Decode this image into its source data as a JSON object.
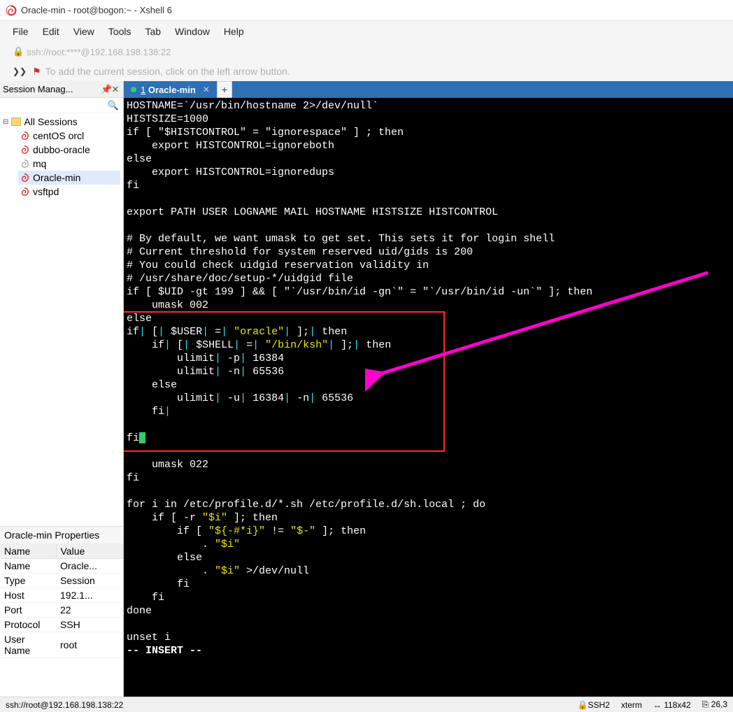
{
  "titlebar": {
    "text": "Oracle-min - root@bogon:~ - Xshell 6"
  },
  "menubar": [
    "File",
    "Edit",
    "View",
    "Tools",
    "Tab",
    "Window",
    "Help"
  ],
  "addressbar": {
    "url": "ssh://root:****@192.168.198.138:22"
  },
  "tipbar": {
    "text": "To add the current session, click on the left arrow button."
  },
  "session_panel": {
    "title": "Session Manag...",
    "root": "All Sessions",
    "items": [
      {
        "name": "centOS orcl",
        "color": "red",
        "selected": false
      },
      {
        "name": "dubbo-oracle",
        "color": "red",
        "selected": false
      },
      {
        "name": "mq",
        "color": "grey",
        "selected": false
      },
      {
        "name": "Oracle-min",
        "color": "red",
        "selected": true
      },
      {
        "name": "vsftpd",
        "color": "red",
        "selected": false
      }
    ]
  },
  "properties": {
    "title": "Oracle-min Properties",
    "headers": {
      "name": "Name",
      "value": "Value"
    },
    "rows": [
      {
        "name": "Name",
        "value": "Oracle..."
      },
      {
        "name": "Type",
        "value": "Session"
      },
      {
        "name": "Host",
        "value": "192.1..."
      },
      {
        "name": "Port",
        "value": "22"
      },
      {
        "name": "Protocol",
        "value": "SSH"
      },
      {
        "name": "User Name",
        "value": "root"
      }
    ]
  },
  "tabs": {
    "active": {
      "num": "1",
      "label": "Oracle-min"
    }
  },
  "terminal_lines": [
    {
      "t": "HOSTNAME=`/usr/bin/hostname 2>/dev/null`"
    },
    {
      "t": "HISTSIZE=1000"
    },
    {
      "t": "if [ \"$HISTCONTROL\" = \"ignorespace\" ] ; then"
    },
    {
      "t": "    export HISTCONTROL=ignoreboth"
    },
    {
      "t": "else"
    },
    {
      "t": "    export HISTCONTROL=ignoredups"
    },
    {
      "t": "fi"
    },
    {
      "t": ""
    },
    {
      "t": "export PATH USER LOGNAME MAIL HOSTNAME HISTSIZE HISTCONTROL"
    },
    {
      "t": ""
    },
    {
      "t": "# By default, we want umask to get set. This sets it for login shell"
    },
    {
      "t": "# Current threshold for system reserved uid/gids is 200"
    },
    {
      "t": "# You could check uidgid reservation validity in"
    },
    {
      "t": "# /usr/share/doc/setup-*/uidgid file"
    },
    {
      "t": "if [ $UID -gt 199 ] && [ \"`/usr/bin/id -gn`\" = \"`/usr/bin/id -un`\" ]; then"
    },
    {
      "t": "    umask 002"
    },
    {
      "t": "else"
    },
    {
      "segs": [
        {
          "s": "if"
        },
        {
          "s": "|",
          "c": "cyan"
        },
        {
          "s": " ["
        },
        {
          "s": "|",
          "c": "cyan"
        },
        {
          "s": " $USER"
        },
        {
          "s": "|",
          "c": "cyan"
        },
        {
          "s": " ="
        },
        {
          "s": "|",
          "c": "cyan"
        },
        {
          "s": " "
        },
        {
          "s": "\"oracle\"",
          "c": "ylw"
        },
        {
          "s": "|",
          "c": "cyan"
        },
        {
          "s": " ];"
        },
        {
          "s": "|",
          "c": "cyan"
        },
        {
          "s": " then"
        }
      ]
    },
    {
      "segs": [
        {
          "s": "    if"
        },
        {
          "s": "|",
          "c": "cyan"
        },
        {
          "s": " ["
        },
        {
          "s": "|",
          "c": "cyan"
        },
        {
          "s": " $SHELL"
        },
        {
          "s": "|",
          "c": "cyan"
        },
        {
          "s": " ="
        },
        {
          "s": "|",
          "c": "cyan"
        },
        {
          "s": " "
        },
        {
          "s": "\"/bin/ksh\"",
          "c": "ylw"
        },
        {
          "s": "|",
          "c": "cyan"
        },
        {
          "s": " ];"
        },
        {
          "s": "|",
          "c": "cyan"
        },
        {
          "s": " then"
        }
      ]
    },
    {
      "segs": [
        {
          "s": "        ulimit"
        },
        {
          "s": "|",
          "c": "cyan"
        },
        {
          "s": " -p"
        },
        {
          "s": "|",
          "c": "cyan"
        },
        {
          "s": " 16384"
        }
      ]
    },
    {
      "segs": [
        {
          "s": "        ulimit"
        },
        {
          "s": "|",
          "c": "cyan"
        },
        {
          "s": " -n"
        },
        {
          "s": "|",
          "c": "cyan"
        },
        {
          "s": " 65536"
        }
      ]
    },
    {
      "t": "    else"
    },
    {
      "segs": [
        {
          "s": "        ulimit"
        },
        {
          "s": "|",
          "c": "cyan"
        },
        {
          "s": " -u"
        },
        {
          "s": "|",
          "c": "cyan"
        },
        {
          "s": " 16384"
        },
        {
          "s": "|",
          "c": "cyan"
        },
        {
          "s": " -n"
        },
        {
          "s": "|",
          "c": "cyan"
        },
        {
          "s": " 65536"
        }
      ]
    },
    {
      "segs": [
        {
          "s": "    fi"
        },
        {
          "s": "|",
          "c": "cyan"
        }
      ]
    },
    {
      "t": ""
    },
    {
      "segs": [
        {
          "s": "fi"
        },
        {
          "cursor": true
        }
      ]
    },
    {
      "t": ""
    },
    {
      "t": "    umask 022"
    },
    {
      "t": "fi"
    },
    {
      "t": ""
    },
    {
      "t": "for i in /etc/profile.d/*.sh /etc/profile.d/sh.local ; do"
    },
    {
      "segs": [
        {
          "s": "    if [ -r "
        },
        {
          "s": "\"$i\"",
          "c": "ylw"
        },
        {
          "s": " ]; then"
        }
      ]
    },
    {
      "segs": [
        {
          "s": "        if [ "
        },
        {
          "s": "\"${-#*i}\"",
          "c": "ylw"
        },
        {
          "s": " != "
        },
        {
          "s": "\"$-\"",
          "c": "ylw"
        },
        {
          "s": " ]; then"
        }
      ]
    },
    {
      "segs": [
        {
          "s": "            . "
        },
        {
          "s": "\"$i\"",
          "c": "ylw"
        }
      ]
    },
    {
      "t": "        else"
    },
    {
      "segs": [
        {
          "s": "            . "
        },
        {
          "s": "\"$i\"",
          "c": "ylw"
        },
        {
          "s": " >/dev/null"
        }
      ]
    },
    {
      "t": "        fi"
    },
    {
      "t": "    fi"
    },
    {
      "t": "done"
    },
    {
      "t": ""
    },
    {
      "t": "unset i"
    },
    {
      "segs": [
        {
          "s": "-- INSERT --",
          "b": true
        }
      ]
    }
  ],
  "statusbar": {
    "left": "ssh://root@192.168.198.138:22",
    "ssh": "SSH2",
    "term": "xterm",
    "size": "118x42",
    "pos": "26,3"
  }
}
